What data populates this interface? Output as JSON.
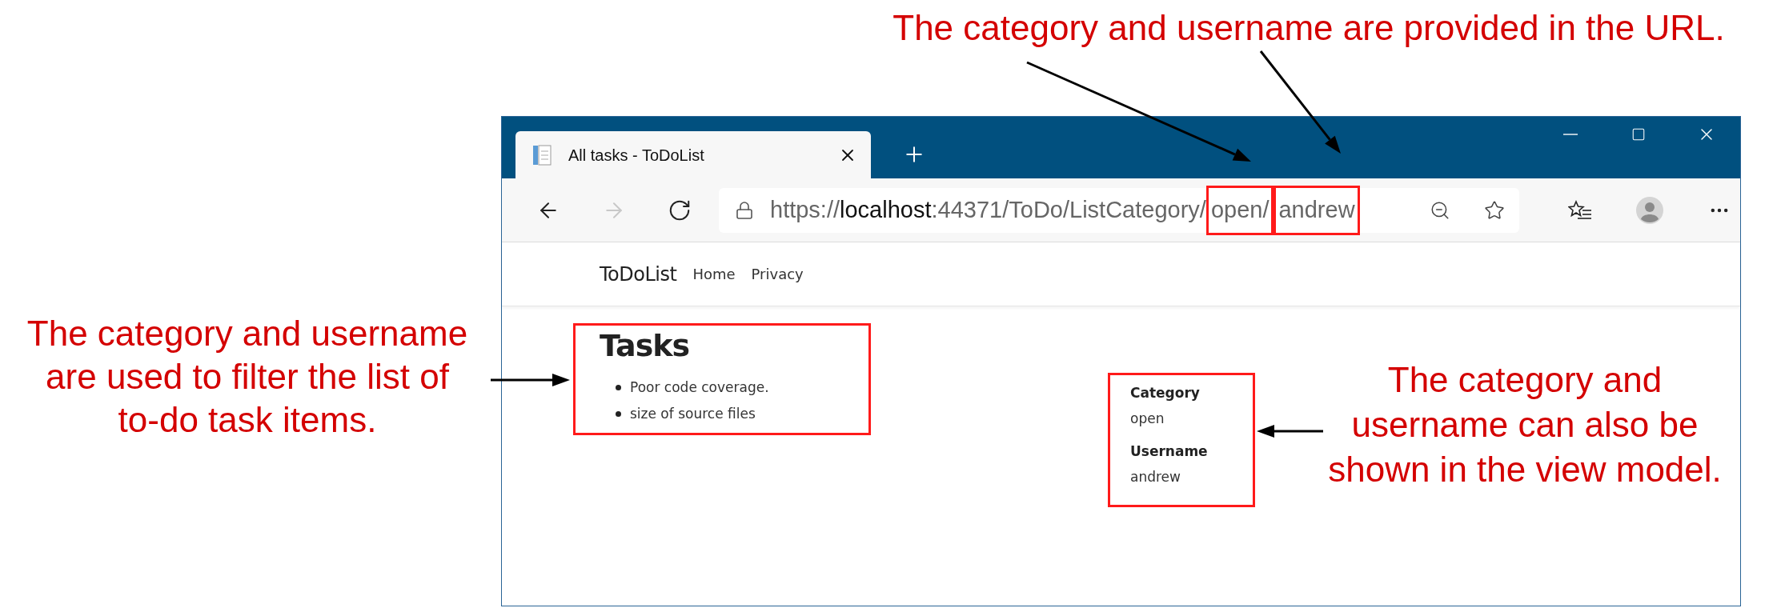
{
  "annotations": {
    "top": "The category and username are provided in the URL.",
    "left": "The category and username\nare used to filter the list of\nto-do task items.",
    "right": "The category and\nusername can also be\nshown in the view model."
  },
  "browser": {
    "tab": {
      "title": "All tasks - ToDoList",
      "selected": true
    },
    "nav_buttons": [
      {
        "kind": "back",
        "disabled": false
      },
      {
        "kind": "forward",
        "disabled": true
      },
      {
        "kind": "refresh",
        "disabled": false
      }
    ],
    "url": [
      {
        "text": "https://",
        "kind": "dim",
        "highlighted": false
      },
      {
        "text": "localhost",
        "kind": "host",
        "highlighted": false
      },
      {
        "text": ":44371/ToDo/ListCategory/",
        "kind": "dim",
        "highlighted": false
      },
      {
        "text": "open/",
        "kind": "dim",
        "highlighted": true
      },
      {
        "text": "andrew",
        "kind": "dim",
        "highlighted": true
      }
    ]
  },
  "site": {
    "brand": "ToDoList",
    "nav": [
      "Home",
      "Privacy"
    ]
  },
  "page": {
    "heading": "Tasks",
    "items": [
      "Poor code coverage.",
      "size of source files"
    ],
    "details": [
      {
        "label": "Category",
        "value": "open"
      },
      {
        "label": "Username",
        "value": "andrew"
      }
    ]
  }
}
